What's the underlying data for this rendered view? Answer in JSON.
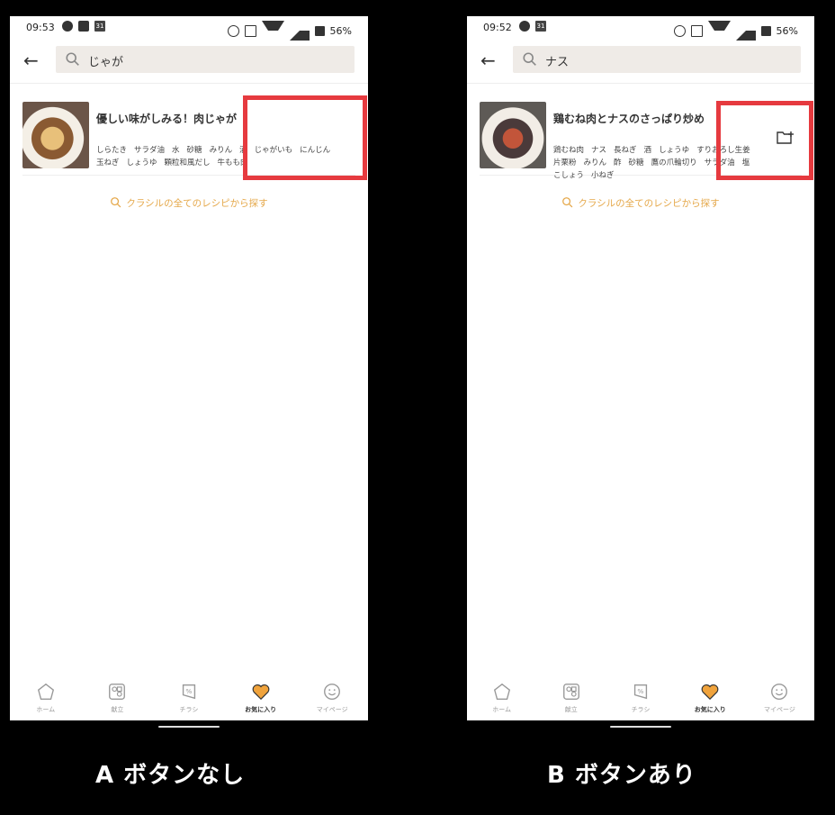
{
  "panels": [
    {
      "id": "a",
      "status_time": "09:53",
      "battery": "56%",
      "search_query": "じゃが",
      "recipe_title": "優しい味がしみる！肉じゃが",
      "ingredients": [
        "しらたき",
        "サラダ油",
        "水",
        "砂糖",
        "みりん",
        "酒",
        "じゃがいも",
        "にんじん",
        "玉ねぎ",
        "しょうゆ",
        "顆粒和風だし",
        "牛もも肉"
      ],
      "search_all_label": "クラシルの全てのレシピから探す",
      "caption": "A ボタンなし",
      "has_add_button": false
    },
    {
      "id": "b",
      "status_time": "09:52",
      "battery": "56%",
      "search_query": "ナス",
      "recipe_title": "鶏むね肉とナスのさっぱり炒め",
      "ingredients": [
        "鶏むね肉",
        "ナス",
        "長ねぎ",
        "酒",
        "しょうゆ",
        "すりおろし生姜",
        "片栗粉",
        "みりん",
        "酢",
        "砂糖",
        "鷹の爪輪切り",
        "サラダ油",
        "塩",
        "こしょう",
        "小ねぎ"
      ],
      "search_all_label": "クラシルの全てのレシピから探す",
      "caption": "B ボタンあり",
      "has_add_button": true
    }
  ],
  "nav": [
    "ホーム",
    "献立",
    "チラシ",
    "お気に入り",
    "マイページ"
  ],
  "nav_active": "お気に入り",
  "colors": {
    "accent": "#e5a84a",
    "highlight": "#e63a3f",
    "search_bg": "#efebe7"
  },
  "icons": [
    "back-arrow-icon",
    "search-icon",
    "folder-add-icon",
    "home-icon",
    "menu-plan-icon",
    "flyer-icon",
    "heart-icon",
    "smiley-icon"
  ]
}
